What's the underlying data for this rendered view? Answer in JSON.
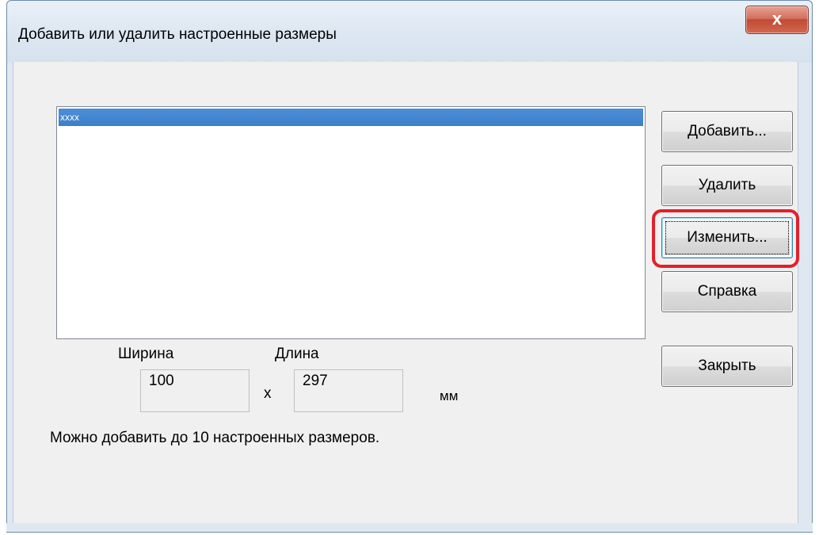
{
  "window": {
    "title": "Добавить или удалить настроенные размеры",
    "close_glyph": "x"
  },
  "list": {
    "items": [
      {
        "label": "xxxx",
        "selected": true
      }
    ]
  },
  "buttons": {
    "add": "Добавить...",
    "delete": "Удалить",
    "edit": "Изменить...",
    "help": "Справка",
    "close": "Закрыть"
  },
  "size": {
    "width_label": "Ширина",
    "length_label": "Длина",
    "width_value": "100",
    "length_value": "297",
    "separator": "x",
    "unit": "мм"
  },
  "note": "Можно добавить до 10 настроенных размеров.",
  "colors": {
    "selection": "#3b7fca",
    "highlight_outline": "#e3202a",
    "close_button": "#c24a33"
  }
}
